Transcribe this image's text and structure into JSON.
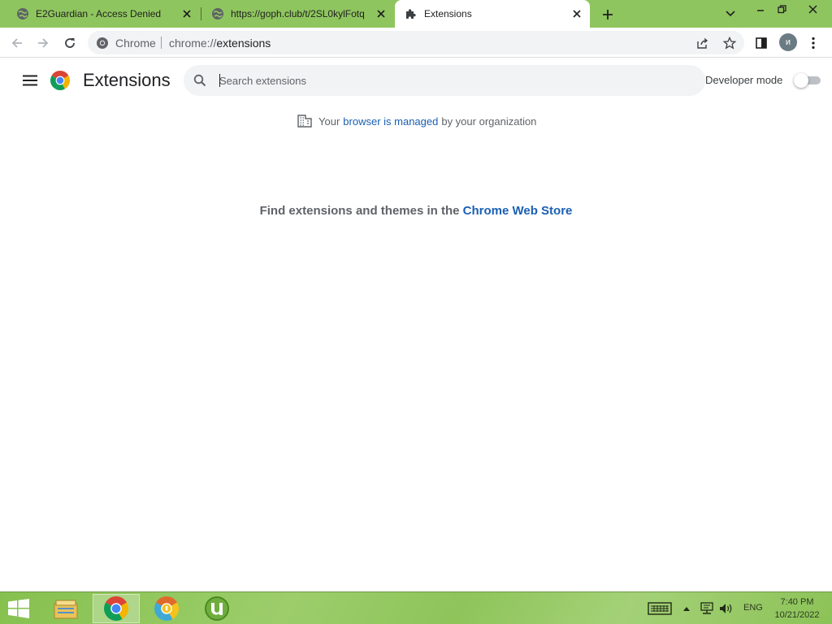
{
  "tabs": [
    {
      "title": "E2Guardian - Access Denied",
      "icon": "globe-icon"
    },
    {
      "title": "https://goph.club/t/2SL0kylFotq",
      "icon": "globe-icon"
    },
    {
      "title": "Extensions",
      "icon": "puzzle-icon",
      "active": true
    }
  ],
  "omnibox": {
    "site_label": "Chrome",
    "url_scheme": "chrome://",
    "url_host": "extensions"
  },
  "profile": {
    "initial": "и"
  },
  "extensions_page": {
    "title": "Extensions",
    "search_placeholder": "Search extensions",
    "developer_mode_label": "Developer mode",
    "developer_mode_enabled": false,
    "managed_notice": {
      "prefix": "Your",
      "link": "browser is managed",
      "suffix": "by your organization"
    },
    "empty_state": {
      "text": "Find extensions and themes in the",
      "link": "Chrome Web Store"
    }
  },
  "taskbar": {
    "apps": [
      "file-explorer-icon",
      "chrome-icon",
      "chrome-canary-icon",
      "utorrent-icon"
    ],
    "language": "ENG",
    "time": "7:40 PM",
    "date": "10/21/2022"
  },
  "colors": {
    "frame": "#8fc55f",
    "link": "#1a5fb4",
    "taskbar": "#8ec45a"
  }
}
